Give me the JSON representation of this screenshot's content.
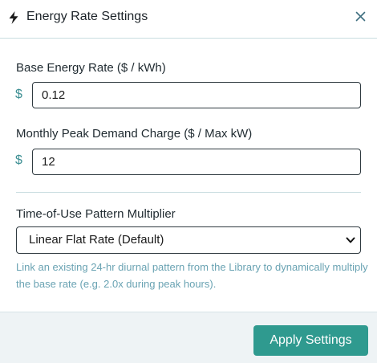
{
  "dialog": {
    "title": "Energy Rate Settings",
    "title_icon": "lightning-bolt-icon",
    "close_icon": "close-icon"
  },
  "fields": {
    "base_rate": {
      "label": "Base Energy Rate ($ / kWh)",
      "currency": "$",
      "value": "0.12"
    },
    "peak_demand": {
      "label": "Monthly Peak Demand Charge ($ / Max kW)",
      "currency": "$",
      "value": "12"
    },
    "tou_pattern": {
      "label": "Time-of-Use Pattern Multiplier",
      "selected": "Linear Flat Rate (Default)",
      "help": "Link an existing 24-hr diurnal pattern from the Library to dynamically multiply the base rate (e.g. 2.0x during peak hours)."
    }
  },
  "footer": {
    "apply_label": "Apply Settings"
  },
  "colors": {
    "accent": "#2f9a8f",
    "currency": "#3d8f93",
    "help_text": "#6aa3b3",
    "footer_bg": "#eef3f5",
    "divider": "#c9dde0"
  }
}
